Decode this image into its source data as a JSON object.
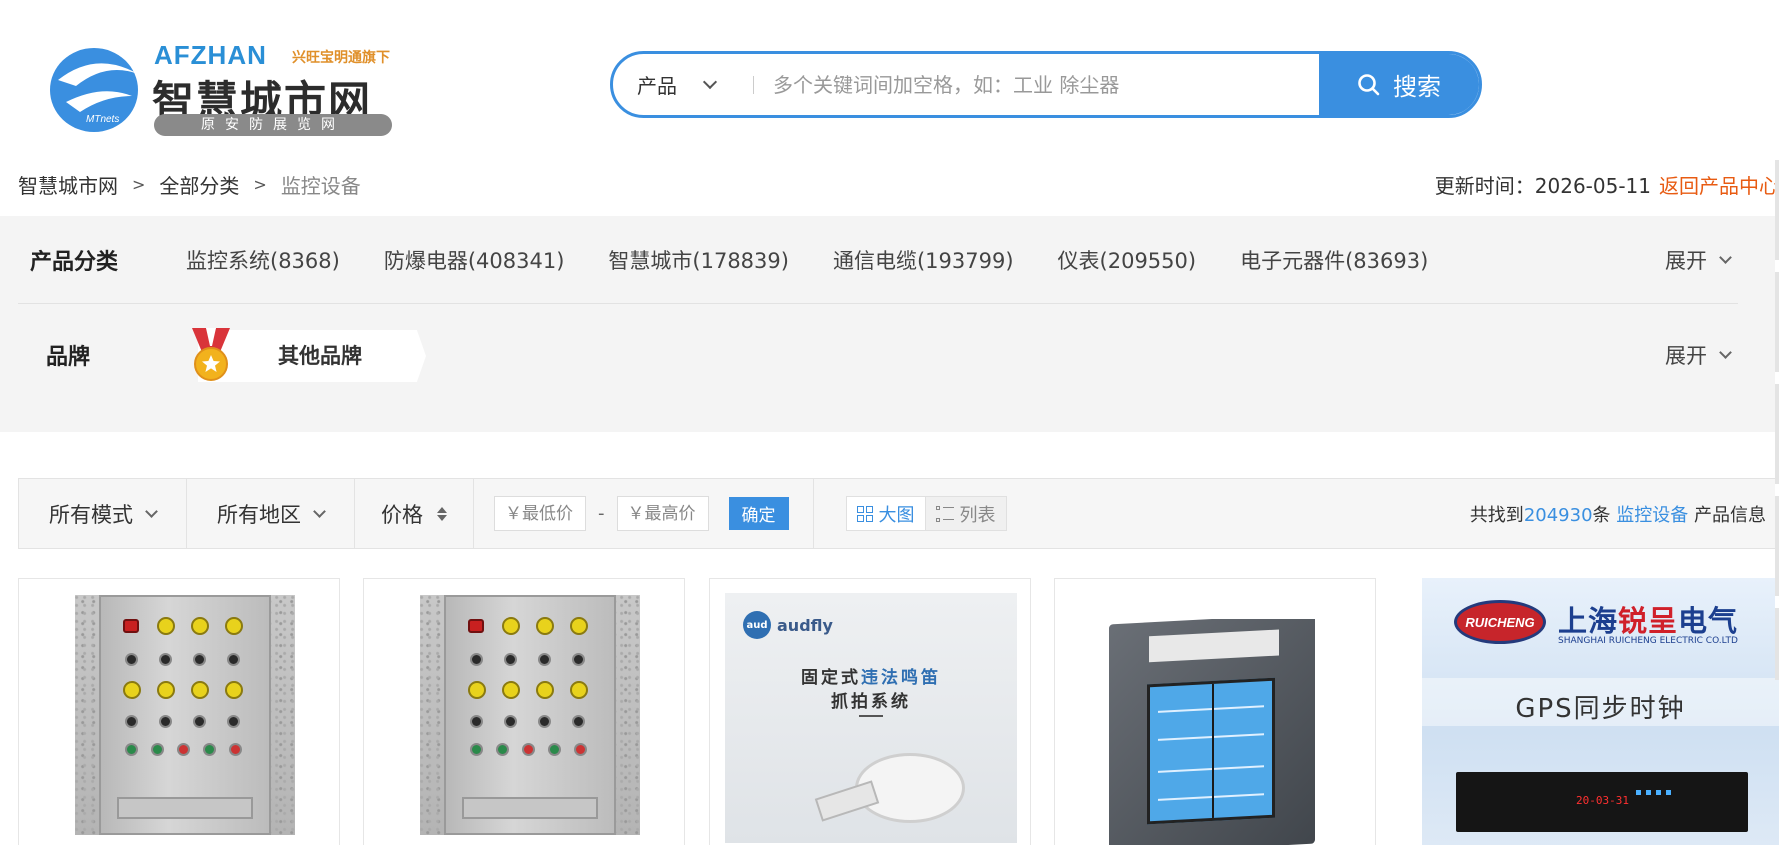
{
  "logo": {
    "brand_en": "AFZHAN",
    "brand_tag": "兴旺宝明通旗下",
    "brand_cn": "智慧城市网",
    "brand_band": "原安防展览网",
    "ring_text": "MTnets"
  },
  "search": {
    "type_label": "产品",
    "placeholder": "多个关键词间加空格，如：工业 除尘器",
    "button_label": "搜索"
  },
  "breadcrumb": {
    "items": [
      "智慧城市网",
      "全部分类",
      "监控设备"
    ],
    "separator": ">"
  },
  "update": {
    "label": "更新时间：2026-05-11",
    "back_link": "返回产品中心"
  },
  "filter": {
    "category_label": "产品分类",
    "categories": [
      "监控系统(8368)",
      "防爆电器(408341)",
      "智慧城市(178839)",
      "通信电缆(193799)",
      "仪表(209550)",
      "电子元器件(83693)"
    ],
    "brand_label": "品牌",
    "brand_chip": "其他品牌",
    "expand_label": "展开"
  },
  "toolbar": {
    "mode": "所有模式",
    "region": "所有地区",
    "price": "价格",
    "min_price_placeholder": "￥最低价",
    "max_price_placeholder": "￥最高价",
    "price_dash": "-",
    "confirm": "确定",
    "view_grid": "大图",
    "view_list": "列表",
    "result_prefix": "共找到",
    "result_count": "204930",
    "result_mid": "条",
    "result_keyword": "监控设备",
    "result_suffix": "产品信息"
  },
  "products": {
    "p3": {
      "brand": "audfly",
      "title_a": "固定式",
      "title_hl": "违法鸣笛",
      "title_b": "抓拍系统"
    },
    "p5": {
      "badge": "RUICHENG",
      "name_a": "上海",
      "name_hl": "锐呈",
      "name_b": "电气",
      "name_en": "SHANGHAI RUICHENG ELECTRIC CO.LTD",
      "product": "GPS同步时钟",
      "display": "20-03-31"
    }
  },
  "colors": {
    "accent": "#3a8fe0",
    "link_orange": "#e85b12",
    "panel_bg": "#f4f4f4"
  }
}
